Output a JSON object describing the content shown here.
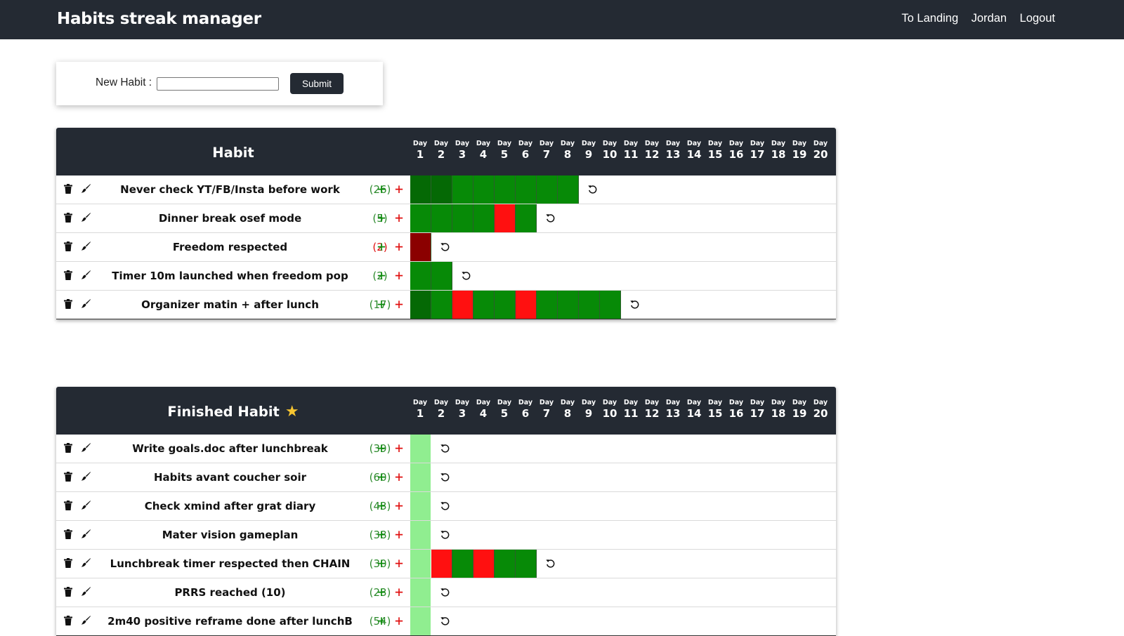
{
  "app": {
    "title": "Habits streak manager"
  },
  "nav": {
    "landing": "To Landing",
    "user": "Jordan",
    "logout": "Logout"
  },
  "new_habit": {
    "label": "New Habit :",
    "value": "",
    "submit": "Submit"
  },
  "colors": {
    "navbar": "#242a33",
    "day_done": "#078a07",
    "day_done_first": "#056905",
    "day_failed": "#ff1010",
    "day_failed_dark": "#8b0000",
    "day_finished": "#90ee90",
    "streak_green": "#2e8b2e",
    "streak_red": "#e01010"
  },
  "day_header": {
    "word": "Day",
    "numbers": [
      "1",
      "2",
      "3",
      "4",
      "5",
      "6",
      "7",
      "8",
      "9",
      "10",
      "11",
      "12",
      "13",
      "14",
      "15",
      "16",
      "17",
      "18",
      "19",
      "20"
    ]
  },
  "habits_table": {
    "title": "Habit",
    "rows": [
      {
        "name": "Never check YT/FB/Insta before work",
        "streak": "(26)",
        "streak_color": "green",
        "days": [
          "done_first",
          "done_first",
          "done",
          "done",
          "done",
          "done",
          "done",
          "done"
        ]
      },
      {
        "name": "Dinner break osef mode",
        "streak": "(5)",
        "streak_color": "green",
        "days": [
          "done",
          "done",
          "done",
          "done",
          "failed",
          "done"
        ]
      },
      {
        "name": "Freedom respected",
        "streak": "(2)",
        "streak_color": "red",
        "days": [
          "failed_dark"
        ]
      },
      {
        "name": "Timer 10m launched when freedom pop",
        "streak": "(2)",
        "streak_color": "green",
        "days": [
          "done",
          "done"
        ]
      },
      {
        "name": "Organizer matin + after lunch",
        "streak": "(17)",
        "streak_color": "green",
        "days": [
          "done_first",
          "done",
          "failed",
          "done",
          "done",
          "failed",
          "done",
          "done",
          "done",
          "done"
        ]
      }
    ]
  },
  "finished_table": {
    "title": "Finished Habit",
    "title_icon": "star-icon",
    "rows": [
      {
        "name": "Write goals.doc after lunchbreak",
        "streak": "(39)",
        "streak_color": "green",
        "days": [
          "finished"
        ]
      },
      {
        "name": "Habits avant coucher soir",
        "streak": "(60)",
        "streak_color": "green",
        "days": [
          "finished"
        ]
      },
      {
        "name": "Check xmind after grat diary",
        "streak": "(43)",
        "streak_color": "green",
        "days": [
          "finished"
        ]
      },
      {
        "name": "Mater vision gameplan",
        "streak": "(38)",
        "streak_color": "green",
        "days": [
          "finished"
        ]
      },
      {
        "name": "Lunchbreak timer respected then CHAIN",
        "streak": "(30)",
        "streak_color": "green",
        "days": [
          "finished",
          "failed",
          "done",
          "failed",
          "done",
          "done"
        ]
      },
      {
        "name": "PRRS reached (10)",
        "streak": "(23)",
        "streak_color": "green",
        "days": [
          "finished"
        ]
      },
      {
        "name": "2m40 positive reframe done after lunchB",
        "streak": "(54)",
        "streak_color": "green",
        "days": [
          "finished"
        ]
      }
    ]
  },
  "row_actions": {
    "delete_icon": "trash-icon",
    "edit_icon": "brush-icon",
    "add_success": "+",
    "add_fail": "+",
    "undo_icon": "undo-icon"
  }
}
